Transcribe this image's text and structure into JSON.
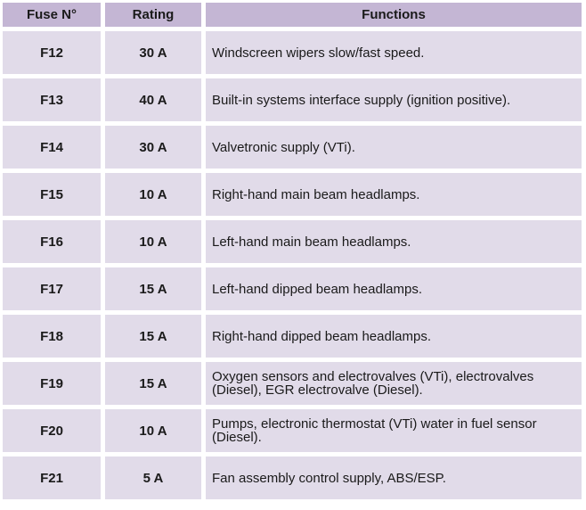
{
  "table": {
    "headers": [
      "Fuse N°",
      "Rating",
      "Functions"
    ],
    "rows": [
      {
        "fuse": "F12",
        "rating": "30 A",
        "function": "Windscreen wipers slow/fast speed."
      },
      {
        "fuse": "F13",
        "rating": "40 A",
        "function": "Built-in systems interface supply (ignition positive)."
      },
      {
        "fuse": "F14",
        "rating": "30 A",
        "function": "Valvetronic supply (VTi)."
      },
      {
        "fuse": "F15",
        "rating": "10 A",
        "function": "Right-hand main beam headlamps."
      },
      {
        "fuse": "F16",
        "rating": "10 A",
        "function": "Left-hand main beam headlamps."
      },
      {
        "fuse": "F17",
        "rating": "15 A",
        "function": "Left-hand dipped beam headlamps."
      },
      {
        "fuse": "F18",
        "rating": "15 A",
        "function": "Right-hand dipped beam headlamps."
      },
      {
        "fuse": "F19",
        "rating": "15 A",
        "function": "Oxygen sensors and electrovalves (VTi), electrovalves (Diesel), EGR electrovalve (Diesel)."
      },
      {
        "fuse": "F20",
        "rating": "10 A",
        "function": "Pumps, electronic thermostat (VTi) water in fuel sensor (Diesel)."
      },
      {
        "fuse": "F21",
        "rating": "5 A",
        "function": "Fan assembly control supply, ABS/ESP."
      }
    ]
  },
  "colors": {
    "header_bg": "#c4b6d4",
    "cell_bg": "#e1dbe9"
  }
}
